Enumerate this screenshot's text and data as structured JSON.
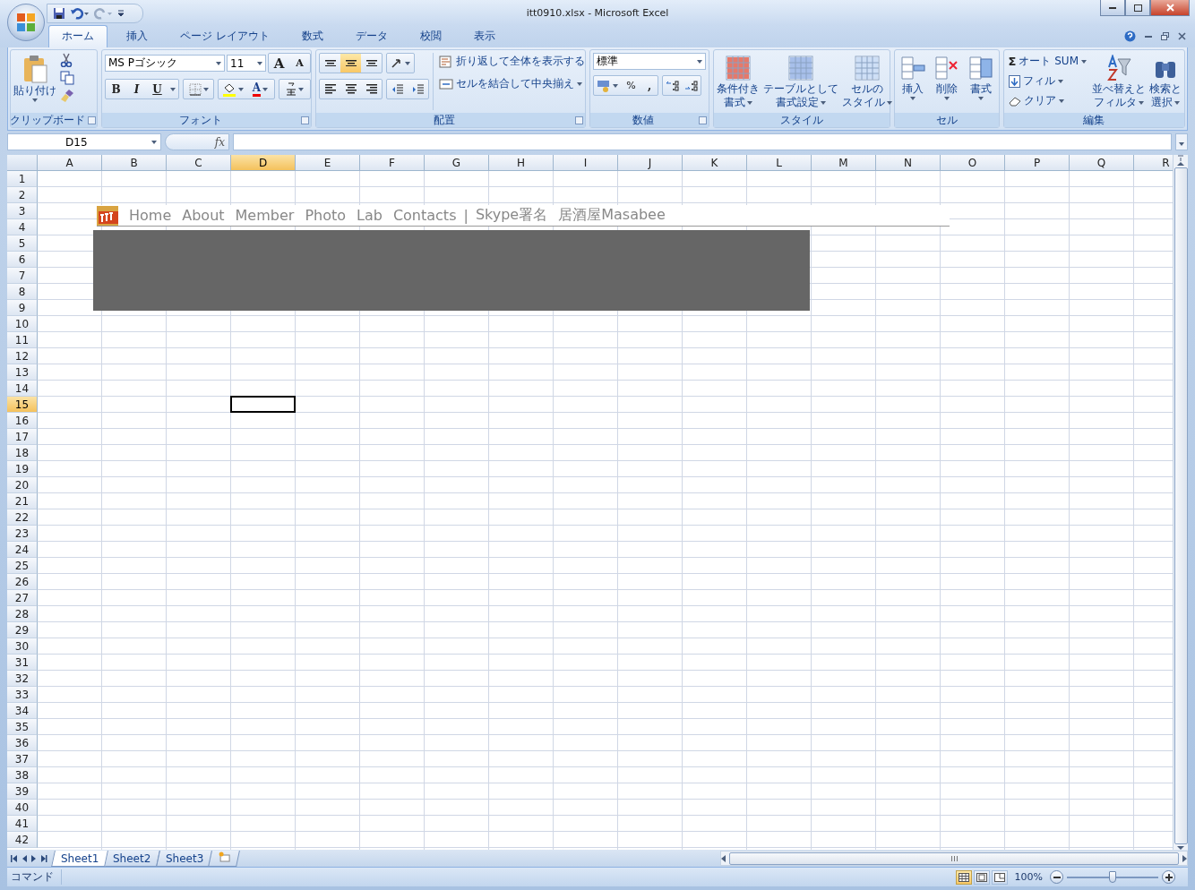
{
  "window": {
    "title": "itt0910.xlsx - Microsoft Excel"
  },
  "ribbon_tabs": [
    {
      "label": "ホーム",
      "selected": true
    },
    {
      "label": "挿入",
      "selected": false
    },
    {
      "label": "ページ レイアウト",
      "selected": false
    },
    {
      "label": "数式",
      "selected": false
    },
    {
      "label": "データ",
      "selected": false
    },
    {
      "label": "校閲",
      "selected": false
    },
    {
      "label": "表示",
      "selected": false
    }
  ],
  "clipboard": {
    "label": "クリップボード",
    "paste": "貼り付け"
  },
  "font": {
    "label": "フォント",
    "name": "MS Pゴシック",
    "size": "11",
    "grow": "A",
    "shrink": "A",
    "bold": "B",
    "italic": "I",
    "underline": "U",
    "font_color_button": "A"
  },
  "alignment": {
    "label": "配置",
    "vertical": [
      {
        "selected": false
      },
      {
        "selected": true
      },
      {
        "selected": false
      }
    ],
    "wrap_text": "折り返して全体を表示する",
    "merge_center": "セルを結合して中央揃え"
  },
  "number": {
    "label": "数値",
    "format": "標準",
    "percent": "%",
    "comma": ","
  },
  "styles": {
    "label": "スタイル",
    "buttons": [
      {
        "lines": [
          "条件付き",
          "書式"
        ]
      },
      {
        "lines": [
          "テーブルとして",
          "書式設定"
        ]
      },
      {
        "lines": [
          "セルの",
          "スタイル"
        ]
      }
    ]
  },
  "cells": {
    "label": "セル",
    "buttons": [
      "挿入",
      "削除",
      "書式"
    ]
  },
  "editing": {
    "label": "編集",
    "sum_symbol": "Σ",
    "autosum": "オート SUM",
    "fill": "フィル",
    "clear": "クリア",
    "buttons": [
      {
        "lines": [
          "並べ替えと",
          "フィルタ"
        ]
      },
      {
        "lines": [
          "検索と",
          "選択"
        ]
      }
    ]
  },
  "formula_bar": {
    "name_box": "D15",
    "function_label": "fx"
  },
  "columns": [
    {
      "label": "A",
      "selected": false
    },
    {
      "label": "B",
      "selected": false
    },
    {
      "label": "C",
      "selected": false
    },
    {
      "label": "D",
      "selected": true
    },
    {
      "label": "E",
      "selected": false
    },
    {
      "label": "F",
      "selected": false
    },
    {
      "label": "G",
      "selected": false
    },
    {
      "label": "H",
      "selected": false
    },
    {
      "label": "I",
      "selected": false
    },
    {
      "label": "J",
      "selected": false
    },
    {
      "label": "K",
      "selected": false
    },
    {
      "label": "L",
      "selected": false
    },
    {
      "label": "M",
      "selected": false
    },
    {
      "label": "N",
      "selected": false
    },
    {
      "label": "O",
      "selected": false
    },
    {
      "label": "P",
      "selected": false
    },
    {
      "label": "Q",
      "selected": false
    },
    {
      "label": "R",
      "selected": false
    }
  ],
  "rows": [
    {
      "label": "1",
      "selected": false
    },
    {
      "label": "2",
      "selected": false
    },
    {
      "label": "3",
      "selected": false
    },
    {
      "label": "4",
      "selected": false
    },
    {
      "label": "5",
      "selected": false
    },
    {
      "label": "6",
      "selected": false
    },
    {
      "label": "7",
      "selected": false
    },
    {
      "label": "8",
      "selected": false
    },
    {
      "label": "9",
      "selected": false
    },
    {
      "label": "10",
      "selected": false
    },
    {
      "label": "11",
      "selected": false
    },
    {
      "label": "12",
      "selected": false
    },
    {
      "label": "13",
      "selected": false
    },
    {
      "label": "14",
      "selected": false
    },
    {
      "label": "15",
      "selected": true
    },
    {
      "label": "16",
      "selected": false
    },
    {
      "label": "17",
      "selected": false
    },
    {
      "label": "18",
      "selected": false
    },
    {
      "label": "19",
      "selected": false
    },
    {
      "label": "20",
      "selected": false
    },
    {
      "label": "21",
      "selected": false
    },
    {
      "label": "22",
      "selected": false
    },
    {
      "label": "23",
      "selected": false
    },
    {
      "label": "24",
      "selected": false
    },
    {
      "label": "25",
      "selected": false
    },
    {
      "label": "26",
      "selected": false
    },
    {
      "label": "27",
      "selected": false
    },
    {
      "label": "28",
      "selected": false
    },
    {
      "label": "29",
      "selected": false
    },
    {
      "label": "30",
      "selected": false
    },
    {
      "label": "31",
      "selected": false
    },
    {
      "label": "32",
      "selected": false
    },
    {
      "label": "33",
      "selected": false
    },
    {
      "label": "34",
      "selected": false
    },
    {
      "label": "35",
      "selected": false
    },
    {
      "label": "36",
      "selected": false
    },
    {
      "label": "37",
      "selected": false
    },
    {
      "label": "38",
      "selected": false
    },
    {
      "label": "39",
      "selected": false
    },
    {
      "label": "40",
      "selected": false
    },
    {
      "label": "41",
      "selected": false
    },
    {
      "label": "42",
      "selected": false
    }
  ],
  "embedded_header": {
    "nav": [
      {
        "kind": "link",
        "label": "Home"
      },
      {
        "kind": "link",
        "label": "About"
      },
      {
        "kind": "link",
        "label": "Member"
      },
      {
        "kind": "link",
        "label": "Photo"
      },
      {
        "kind": "link",
        "label": "Lab"
      },
      {
        "kind": "link",
        "label": "Contacts"
      },
      {
        "kind": "separator",
        "label": "|"
      },
      {
        "kind": "link",
        "label": "Skype署名"
      },
      {
        "kind": "link",
        "label": "居酒屋Masabee"
      }
    ]
  },
  "sheet_tabs": [
    {
      "label": "Sheet1",
      "selected": true
    },
    {
      "label": "Sheet2",
      "selected": false
    },
    {
      "label": "Sheet3",
      "selected": false
    }
  ],
  "status_bar": {
    "mode": "コマンド",
    "view_modes": [
      {
        "selected": true
      },
      {
        "selected": false
      },
      {
        "selected": false
      }
    ],
    "zoom": "100%",
    "zoom_slider": {
      "level": 0.5
    }
  }
}
